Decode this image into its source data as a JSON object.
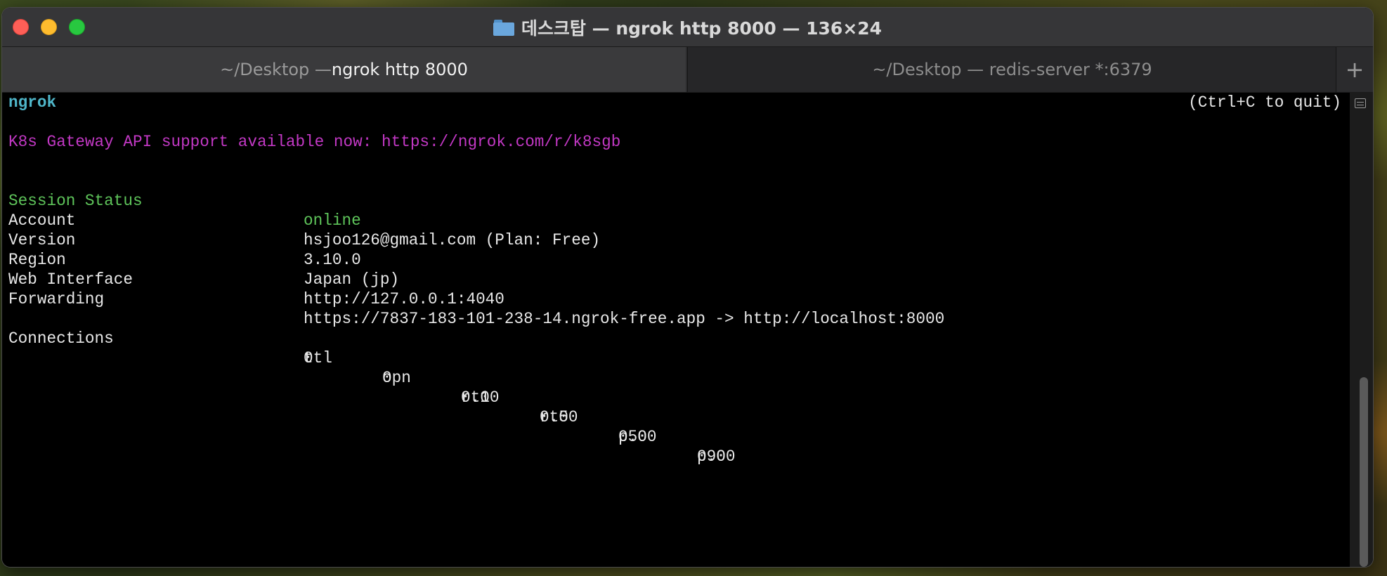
{
  "window": {
    "title": "데스크탑 — ngrok http 8000 — 136×24"
  },
  "tabs": [
    {
      "dim": "~/Desktop — ",
      "bright": "ngrok http 8000"
    },
    {
      "dim": "~/Desktop — redis-server *:6379"
    }
  ],
  "terminal": {
    "app_name": "ngrok",
    "quit_hint": "(Ctrl+C to quit)",
    "announcement": "K8s Gateway API support available now: https://ngrok.com/r/k8sgb",
    "session_status": {
      "key": "Session Status",
      "value": "online"
    },
    "account": {
      "key": "Account",
      "value": "hsjoo126@gmail.com (Plan: Free)"
    },
    "version": {
      "key": "Version",
      "value": "3.10.0"
    },
    "region": {
      "key": "Region",
      "value": "Japan (jp)"
    },
    "web_interface": {
      "key": "Web Interface",
      "value": "http://127.0.0.1:4040"
    },
    "forwarding": {
      "key": "Forwarding",
      "value": "https://7837-183-101-238-14.ngrok-free.app -> http://localhost:8000"
    },
    "connections": {
      "key": "Connections",
      "headers": [
        "ttl",
        "opn",
        "rt1",
        "rt5",
        "p50",
        "p90"
      ],
      "values": [
        "0",
        "0",
        "0.00",
        "0.00",
        "0.00",
        "0.00"
      ]
    }
  },
  "colors": {
    "status_online": "#5ec45a",
    "announcement": "#c238c4",
    "app_name": "#4fb6c9"
  }
}
